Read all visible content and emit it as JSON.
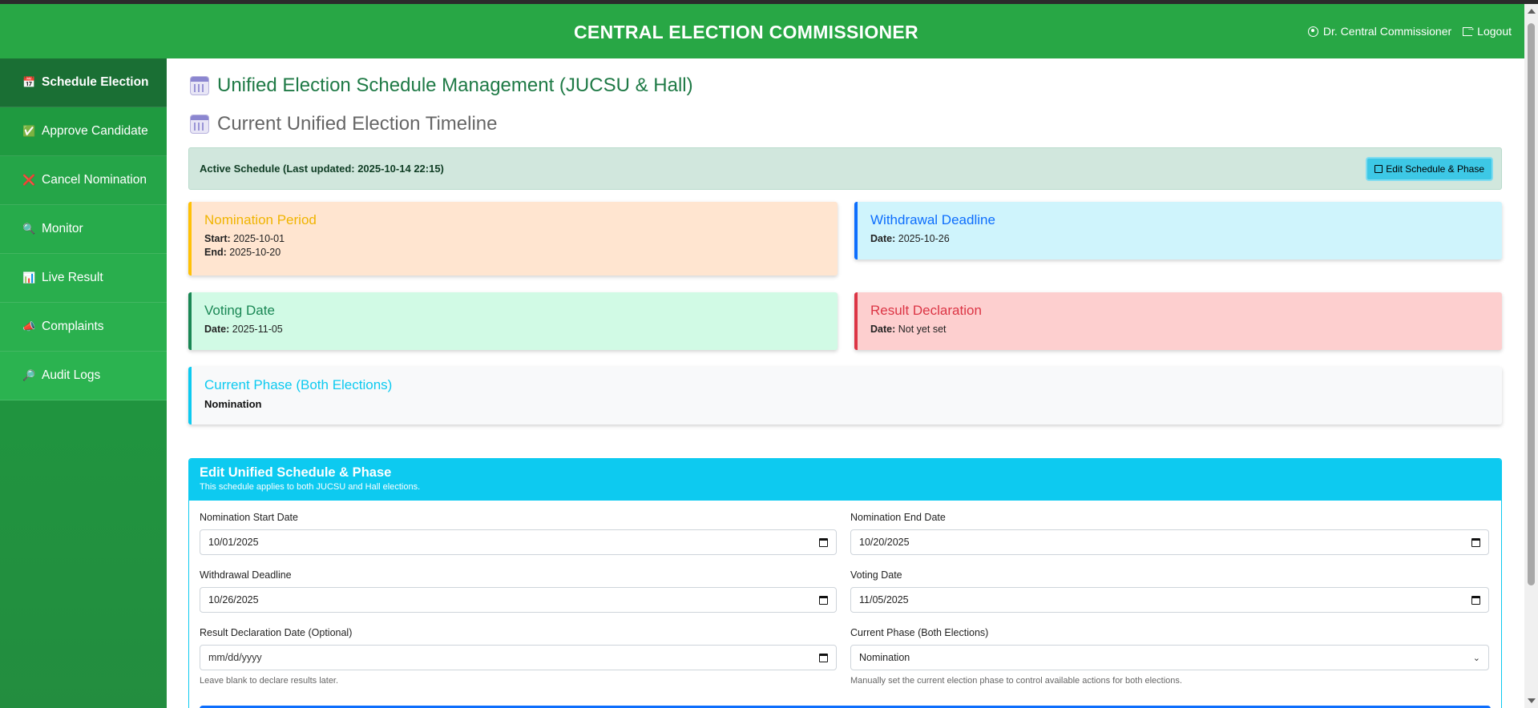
{
  "header": {
    "title": "CENTRAL ELECTION COMMISSIONER",
    "user_name": "Dr. Central Commissioner",
    "logout_label": "Logout"
  },
  "sidebar": {
    "items": [
      {
        "label": "Schedule Election",
        "icon": "calendar-icon",
        "glyph": "📅"
      },
      {
        "label": "Approve Candidate",
        "icon": "check-box-icon",
        "glyph": "✅"
      },
      {
        "label": "Cancel Nomination",
        "icon": "cross-icon",
        "glyph": "❌"
      },
      {
        "label": "Monitor",
        "icon": "magnifier-icon",
        "glyph": "🔍"
      },
      {
        "label": "Live Result",
        "icon": "bar-chart-icon",
        "glyph": "📊"
      },
      {
        "label": "Complaints",
        "icon": "megaphone-icon",
        "glyph": "📣"
      },
      {
        "label": "Audit Logs",
        "icon": "magnifier-right-icon",
        "glyph": "🔎"
      }
    ]
  },
  "main": {
    "title": "Unified Election Schedule Management (JUCSU & Hall)",
    "subtitle": "Current Unified Election Timeline",
    "active_schedule": "Active Schedule (Last updated: 2025-10-14 22:15)",
    "edit_button": "Edit Schedule & Phase"
  },
  "cards": {
    "nomination": {
      "title": "Nomination Period",
      "start_label": "Start:",
      "start": "2025-10-01",
      "end_label": "End:",
      "end": "2025-10-20"
    },
    "withdrawal": {
      "title": "Withdrawal Deadline",
      "date_label": "Date:",
      "date": "2025-10-26"
    },
    "voting": {
      "title": "Voting Date",
      "date_label": "Date:",
      "date": "2025-11-05"
    },
    "result": {
      "title": "Result Declaration",
      "date_label": "Date:",
      "date": "Not yet set"
    },
    "phase": {
      "title": "Current Phase (Both Elections)",
      "value": "Nomination"
    }
  },
  "edit_form": {
    "heading": "Edit Unified Schedule & Phase",
    "subheading": "This schedule applies to both JUCSU and Hall elections.",
    "nomination_start": {
      "label": "Nomination Start Date",
      "value": "10/01/2025"
    },
    "nomination_end": {
      "label": "Nomination End Date",
      "value": "10/20/2025"
    },
    "withdrawal": {
      "label": "Withdrawal Deadline",
      "value": "10/26/2025"
    },
    "voting": {
      "label": "Voting Date",
      "value": "11/05/2025"
    },
    "result": {
      "label": "Result Declaration Date (Optional)",
      "placeholder": "mm/dd/yyyy",
      "hint": "Leave blank to declare results later."
    },
    "phase": {
      "label": "Current Phase (Both Elections)",
      "value": "Nomination",
      "hint": "Manually set the current election phase to control available actions for both elections."
    }
  }
}
